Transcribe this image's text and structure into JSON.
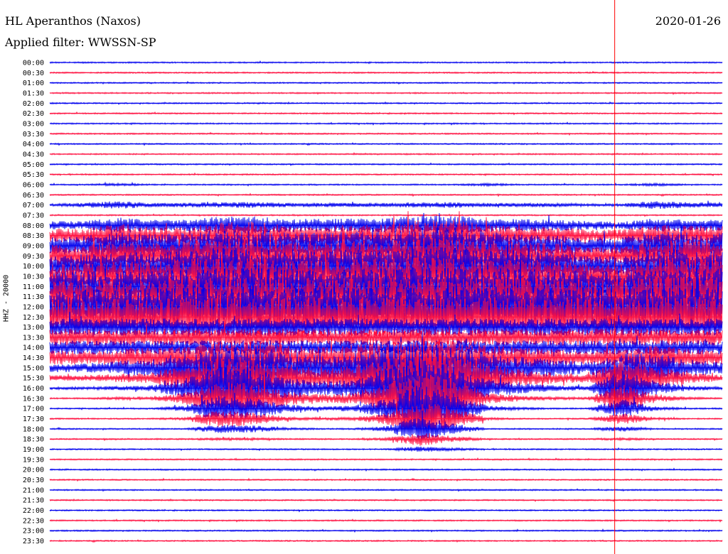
{
  "header": {
    "station": "HL Aperanthos (Naxos)",
    "date": "2020-01-26",
    "filter": "Applied filter: WWSSN-SP"
  },
  "chart_data": {
    "type": "line",
    "title": "HL Aperanthos (Naxos)",
    "subtitle": "Applied filter: WWSSN-SP",
    "ylabel": "HHZ - 20000",
    "xlabel": "",
    "grid": false,
    "colors": {
      "even": "#0000ee",
      "odd": "#ff1040",
      "marker": "#ff0000"
    },
    "row_times": [
      "00:00",
      "00:30",
      "01:00",
      "01:30",
      "02:00",
      "02:30",
      "03:00",
      "03:30",
      "04:00",
      "04:30",
      "05:00",
      "05:30",
      "06:00",
      "06:30",
      "07:00",
      "07:30",
      "08:00",
      "08:30",
      "09:00",
      "09:30",
      "10:00",
      "10:30",
      "11:00",
      "11:30",
      "12:00",
      "12:30",
      "13:00",
      "13:30",
      "14:00",
      "14:30",
      "15:00",
      "15:30",
      "16:00",
      "16:30",
      "17:00",
      "17:30",
      "18:00",
      "18:30",
      "19:00",
      "19:30",
      "20:00",
      "20:30",
      "21:00",
      "21:30",
      "22:00",
      "22:30",
      "23:00",
      "23:30"
    ],
    "current_time_fraction": 0.84,
    "amplitude_envelope": {
      "x": [
        0,
        0.05,
        0.1,
        0.15,
        0.2,
        0.25,
        0.3,
        0.35,
        0.4,
        0.45,
        0.5,
        0.55,
        0.6,
        0.65,
        0.7,
        0.75,
        0.8,
        0.85,
        0.9,
        0.95,
        1.0
      ],
      "rows": {
        "00:00": [
          1,
          1,
          1,
          1,
          1,
          1,
          1,
          1,
          1,
          1,
          1,
          1,
          1,
          1,
          1,
          1,
          1,
          1,
          1,
          1,
          1
        ],
        "03:00": [
          1,
          1,
          1,
          1,
          1,
          1,
          1,
          1,
          1,
          1,
          1,
          1,
          1,
          1,
          1,
          1,
          1,
          1,
          1,
          1,
          1
        ],
        "06:00": [
          1,
          1,
          2,
          1,
          1,
          1,
          1,
          1,
          1,
          1,
          1,
          1,
          1,
          2,
          1,
          1,
          1,
          1,
          2,
          1,
          1
        ],
        "07:00": [
          2,
          3,
          6,
          3,
          3,
          4,
          4,
          3,
          3,
          3,
          3,
          4,
          4,
          3,
          3,
          3,
          2,
          2,
          6,
          4,
          3
        ],
        "08:00": [
          6,
          6,
          12,
          8,
          8,
          12,
          14,
          10,
          9,
          10,
          10,
          14,
          14,
          10,
          9,
          8,
          6,
          5,
          10,
          8,
          8
        ],
        "08:30": [
          10,
          10,
          18,
          12,
          12,
          18,
          20,
          15,
          14,
          15,
          15,
          22,
          22,
          15,
          13,
          12,
          9,
          9,
          16,
          14,
          14
        ],
        "09:00": [
          14,
          14,
          20,
          16,
          18,
          22,
          24,
          20,
          18,
          20,
          20,
          26,
          26,
          20,
          17,
          16,
          12,
          12,
          20,
          20,
          18
        ],
        "09:30": [
          16,
          18,
          20,
          18,
          22,
          24,
          26,
          22,
          20,
          22,
          22,
          26,
          26,
          22,
          20,
          18,
          12,
          12,
          22,
          22,
          22
        ],
        "10:00": [
          16,
          18,
          20,
          20,
          24,
          26,
          26,
          24,
          22,
          24,
          24,
          28,
          26,
          24,
          22,
          20,
          14,
          14,
          24,
          24,
          22
        ],
        "10:30": [
          18,
          20,
          20,
          22,
          26,
          26,
          26,
          24,
          24,
          24,
          26,
          28,
          26,
          24,
          24,
          22,
          18,
          18,
          26,
          26,
          24
        ],
        "11:00": [
          20,
          22,
          22,
          22,
          26,
          26,
          26,
          26,
          24,
          26,
          26,
          28,
          28,
          26,
          26,
          24,
          22,
          22,
          28,
          28,
          26
        ],
        "11:30": [
          22,
          22,
          24,
          24,
          28,
          28,
          28,
          26,
          26,
          26,
          28,
          30,
          28,
          28,
          28,
          26,
          26,
          26,
          30,
          28,
          28
        ],
        "12:00": [
          24,
          24,
          26,
          26,
          28,
          28,
          30,
          28,
          28,
          28,
          28,
          30,
          30,
          28,
          28,
          28,
          28,
          28,
          30,
          30,
          28
        ],
        "12:30": [
          26,
          26,
          26,
          26,
          28,
          28,
          30,
          28,
          28,
          28,
          30,
          30,
          30,
          28,
          28,
          28,
          28,
          28,
          30,
          30,
          28
        ],
        "13:00": [
          12,
          12,
          12,
          12,
          12,
          12,
          12,
          12,
          12,
          12,
          12,
          12,
          12,
          12,
          12,
          12,
          12,
          12,
          12,
          12,
          12
        ],
        "13:30": [
          12,
          12,
          12,
          12,
          12,
          12,
          12,
          12,
          12,
          12,
          12,
          12,
          12,
          12,
          12,
          12,
          12,
          12,
          12,
          12,
          12
        ],
        "14:00": [
          10,
          10,
          10,
          10,
          10,
          10,
          10,
          10,
          10,
          10,
          10,
          10,
          10,
          10,
          10,
          10,
          10,
          10,
          10,
          10,
          10
        ],
        "14:30": [
          10,
          10,
          12,
          14,
          18,
          22,
          24,
          18,
          16,
          18,
          22,
          26,
          24,
          18,
          14,
          12,
          10,
          14,
          18,
          12,
          10
        ],
        "15:00": [
          6,
          6,
          10,
          12,
          22,
          28,
          30,
          22,
          18,
          22,
          30,
          36,
          32,
          22,
          16,
          12,
          8,
          22,
          20,
          12,
          8
        ],
        "15:30": [
          4,
          4,
          6,
          8,
          18,
          30,
          30,
          20,
          14,
          18,
          30,
          40,
          34,
          20,
          12,
          8,
          6,
          26,
          16,
          8,
          4
        ],
        "16:00": [
          2,
          2,
          3,
          4,
          14,
          30,
          28,
          16,
          10,
          12,
          28,
          42,
          34,
          14,
          8,
          4,
          3,
          26,
          10,
          4,
          2
        ],
        "16:30": [
          1,
          1,
          2,
          2,
          8,
          24,
          22,
          10,
          6,
          8,
          22,
          40,
          30,
          8,
          4,
          2,
          2,
          20,
          6,
          2,
          1
        ],
        "17:00": [
          1,
          1,
          1,
          1,
          4,
          18,
          16,
          6,
          3,
          4,
          14,
          34,
          24,
          4,
          2,
          1,
          1,
          14,
          3,
          1,
          1
        ],
        "17:30": [
          1,
          1,
          1,
          1,
          2,
          12,
          10,
          3,
          2,
          2,
          8,
          26,
          16,
          2,
          1,
          1,
          1,
          8,
          2,
          1,
          1
        ],
        "18:00": [
          1,
          1,
          1,
          1,
          1,
          6,
          5,
          2,
          1,
          1,
          4,
          18,
          8,
          1,
          1,
          1,
          1,
          4,
          1,
          1,
          1
        ],
        "18:30": [
          1,
          1,
          1,
          1,
          1,
          2,
          2,
          1,
          1,
          1,
          2,
          10,
          4,
          1,
          1,
          1,
          1,
          2,
          1,
          1,
          1
        ],
        "19:00": [
          1,
          1,
          1,
          1,
          1,
          1,
          1,
          1,
          1,
          1,
          1,
          4,
          2,
          1,
          1,
          1,
          1,
          1,
          1,
          1,
          1
        ],
        "default": [
          1,
          1,
          1,
          1,
          1,
          1,
          1,
          1,
          1,
          1,
          1,
          1,
          1,
          1,
          1,
          1,
          1,
          1,
          1,
          1,
          1
        ]
      }
    }
  }
}
